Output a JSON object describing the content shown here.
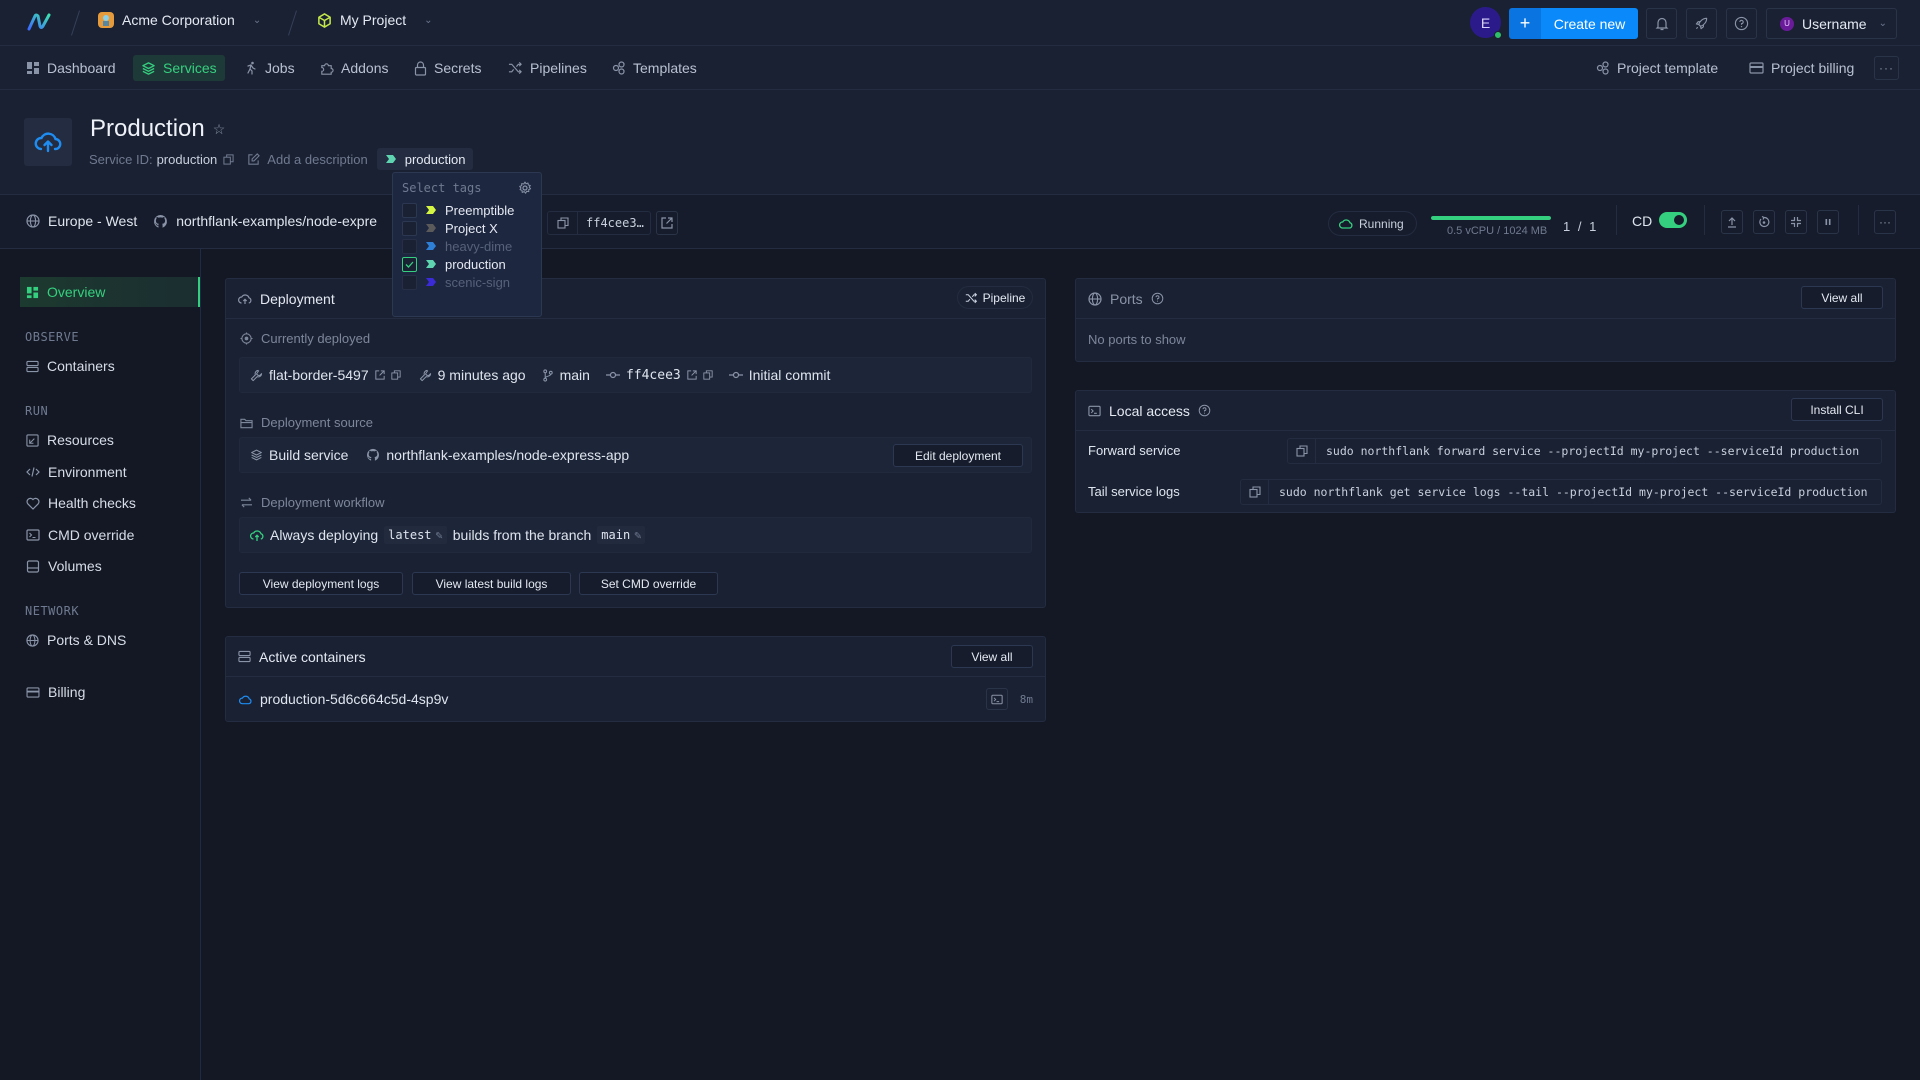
{
  "topbar": {
    "org": "Acme Corporation",
    "project": "My Project",
    "avatar_initial": "E",
    "create_label": "Create new",
    "user_initial": "U",
    "username": "Username"
  },
  "nav": {
    "items": [
      {
        "label": "Dashboard",
        "icon": "dashboard-icon"
      },
      {
        "label": "Services",
        "icon": "layers-icon",
        "active": true
      },
      {
        "label": "Jobs",
        "icon": "runner-icon"
      },
      {
        "label": "Addons",
        "icon": "puzzle-icon"
      },
      {
        "label": "Secrets",
        "icon": "lock-icon"
      },
      {
        "label": "Pipelines",
        "icon": "shuffle-icon"
      },
      {
        "label": "Templates",
        "icon": "template-icon"
      }
    ],
    "right": [
      {
        "label": "Project template",
        "icon": "template-icon"
      },
      {
        "label": "Project billing",
        "icon": "card-icon"
      }
    ],
    "more": "···"
  },
  "header": {
    "title": "Production",
    "service_id_label": "Service ID:",
    "service_id": "production",
    "add_description": "Add a description",
    "tag": "production"
  },
  "tags_dropdown": {
    "title": "Select tags",
    "items": [
      {
        "label": "Preemptible",
        "checked": false,
        "color": "#d4f542",
        "enabled": true
      },
      {
        "label": "Project X",
        "checked": false,
        "color": "#5a5a5a",
        "enabled": true
      },
      {
        "label": "heavy-dime",
        "checked": false,
        "color": "#2e7fd6",
        "enabled": false
      },
      {
        "label": "production",
        "checked": true,
        "color": "#5fd4b0",
        "enabled": true
      },
      {
        "label": "scenic-sign",
        "checked": false,
        "color": "#3a2bd6",
        "enabled": false
      }
    ]
  },
  "infobar": {
    "region": "Europe - West",
    "repo": "northflank-examples/node-expre",
    "commit": "ff4cee3…",
    "status": "Running",
    "resource_usage": 1.0,
    "resources": "0.5 vCPU / 1024 MB",
    "instances": "1 / 1",
    "cd_label": "CD",
    "cd_enabled": true,
    "more": "···"
  },
  "sidebar": {
    "overview": "Overview",
    "sections": [
      {
        "heading": "OBSERVE",
        "items": [
          {
            "label": "Containers",
            "icon": "containers-icon"
          }
        ]
      },
      {
        "heading": "RUN",
        "items": [
          {
            "label": "Resources",
            "icon": "resources-icon"
          },
          {
            "label": "Environment",
            "icon": "code-icon"
          },
          {
            "label": "Health checks",
            "icon": "heart-icon"
          },
          {
            "label": "CMD override",
            "icon": "terminal-icon"
          },
          {
            "label": "Volumes",
            "icon": "drive-icon"
          }
        ]
      },
      {
        "heading": "NETWORK",
        "items": [
          {
            "label": "Ports & DNS",
            "icon": "globe-icon"
          }
        ]
      }
    ],
    "billing": "Billing"
  },
  "deployment": {
    "title": "Deployment",
    "pipeline_label": "Pipeline",
    "currently_deployed": "Currently deployed",
    "build_name": "flat-border-5497",
    "time_ago": "9 minutes ago",
    "branch": "main",
    "commit": "ff4cee3",
    "commit_message": "Initial commit",
    "source_label": "Deployment source",
    "source_type": "Build service",
    "source_repo": "northflank-examples/node-express-app",
    "edit_label": "Edit deployment",
    "workflow_label": "Deployment workflow",
    "workflow_prefix": "Always deploying",
    "workflow_tag": "latest",
    "workflow_mid": "builds from the branch",
    "workflow_branch": "main",
    "buttons": [
      "View deployment logs",
      "View latest build logs",
      "Set CMD override"
    ]
  },
  "containers": {
    "title": "Active containers",
    "view_all": "View all",
    "items": [
      {
        "name": "production-5d6c664c5d-4sp9v",
        "age": "8m"
      }
    ]
  },
  "ports": {
    "title": "Ports",
    "view_all": "View all",
    "empty": "No ports to show"
  },
  "local_access": {
    "title": "Local access",
    "install_label": "Install CLI",
    "rows": [
      {
        "label": "Forward service",
        "command": "sudo northflank forward service --projectId my-project --serviceId production"
      },
      {
        "label": "Tail service logs",
        "command": "sudo northflank get service logs --tail --projectId my-project --serviceId production"
      }
    ]
  },
  "colors": {
    "accent_green": "#35d07f",
    "primary_blue": "#0a8afa",
    "background": "#131824",
    "panel": "#1a2133"
  }
}
